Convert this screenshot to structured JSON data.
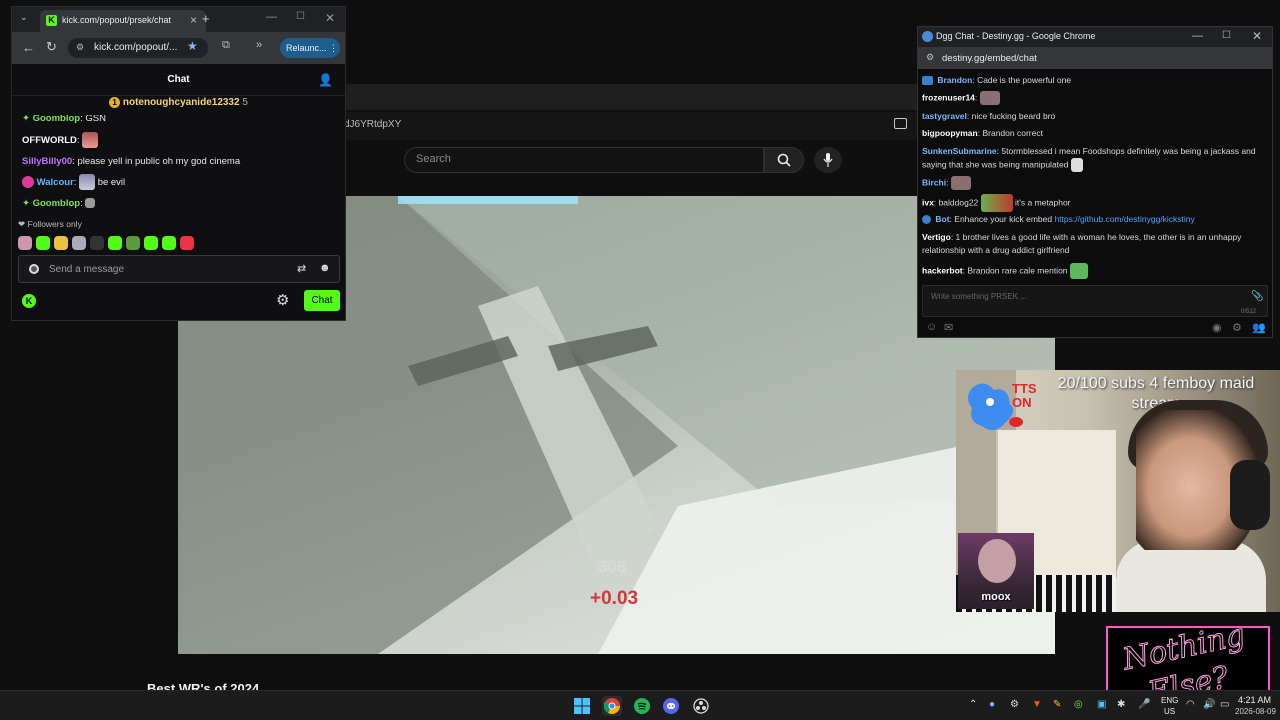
{
  "background_page": {
    "address_fragment": "dJ6YRtdpXY",
    "search_placeholder": "Search",
    "video_counter": "308",
    "video_delta": "+0.03",
    "video_title": "Best WR's of 2024"
  },
  "kick_window": {
    "tab_title": "kick.com/popout/prsek/chat",
    "url": "kick.com/popout/...",
    "relaunch_label": "Relaunc...",
    "chat_title": "Chat",
    "pinned": {
      "user": "notenoughcyanide12332",
      "count": "5"
    },
    "messages": [
      {
        "user": "Goomblop",
        "user_color": "#7ee05b",
        "text": "GSN"
      },
      {
        "user": "OFFWORLD",
        "user_color": "#ffffff",
        "text": ""
      },
      {
        "user": "SillyBilly00",
        "user_color": "#c573ff",
        "text": "please yell in public oh my god cinema"
      },
      {
        "user": "Walcour",
        "user_color": "#64b5ff",
        "text": "be evil"
      },
      {
        "user": "Goomblop",
        "user_color": "#7ee05b",
        "text": ""
      }
    ],
    "followers_only": "Followers only",
    "input_placeholder": "Send a message",
    "chat_button": "Chat"
  },
  "dgg_window": {
    "title": "Dgg Chat - Destiny.gg - Google Chrome",
    "url": "destiny.gg/embed/chat",
    "messages": [
      {
        "user": "Brandon",
        "user_color": "#7ab8ff",
        "text": "Cade is the powerful one",
        "link": ""
      },
      {
        "user": "frozenuser14",
        "user_color": "#ffffff",
        "text": "",
        "link": ""
      },
      {
        "user": "tastygravel",
        "user_color": "#7ab8ff",
        "text": "nice fucking beard bro",
        "link": ""
      },
      {
        "user": "bigpoopyman",
        "user_color": "#ffffff",
        "text": "Brandon correct",
        "link": ""
      },
      {
        "user": "SunkenSubmarine",
        "user_color": "#7ab8ff",
        "text": "5tormblessed i mean Foodshops definitely was being a jackass and saying that she was being manipulated",
        "link": ""
      },
      {
        "user": "Birchi",
        "user_color": "#7ab8ff",
        "text": "",
        "link": ""
      },
      {
        "user": "ivx",
        "user_color": "#ffffff",
        "text": "balddog22",
        "text2": "it's a metaphor",
        "link": ""
      },
      {
        "user": "Bot",
        "user_color": "#7ab8ff",
        "text": "Enhance your kick embed ",
        "link": "https://github.com/destinygg/kickstiny"
      },
      {
        "user": "Vertigo",
        "user_color": "#ffffff",
        "text": "1 brother lives a good life with a woman he loves, the other is in an unhappy relationship with a drug addict girlfriend",
        "link": ""
      },
      {
        "user": "hackerbot",
        "user_color": "#ffffff",
        "text": "Brandon rare cale mention",
        "link": ""
      }
    ],
    "input_placeholder": "Write something PRSEK ...",
    "char_count": "0/512"
  },
  "webcam": {
    "tts": "TTS ON",
    "goal_text": "20/100 subs 4 femboy maid stream",
    "guest_name": "moox"
  },
  "overlay_logo": {
    "line1": "Nothing",
    "line2": "Else?"
  },
  "taskbar": {
    "lang_line1": "ENG",
    "lang_line2": "US",
    "time": "4:21 AM",
    "date": "2026-08-09"
  }
}
